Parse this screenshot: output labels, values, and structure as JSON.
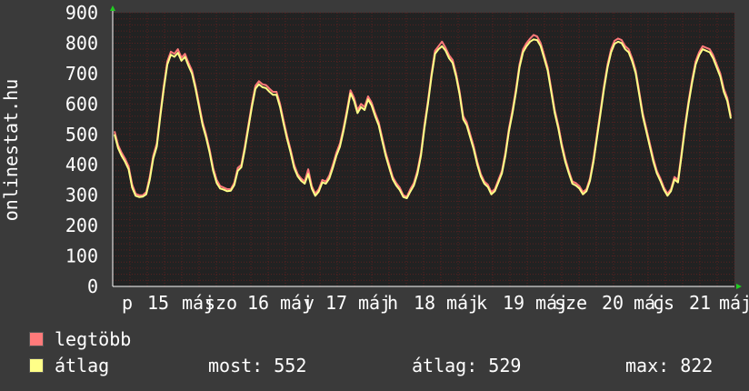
{
  "chart_data": {
    "type": "line",
    "ylabel": "onlinestat.hu",
    "ylim": [
      0,
      900
    ],
    "yticks": [
      0,
      100,
      200,
      300,
      400,
      500,
      600,
      700,
      800,
      900
    ],
    "x_tick_labels": [
      "p",
      "15",
      "máj",
      "szo",
      "16",
      "máj",
      "v",
      "17",
      "máj",
      "h",
      "18",
      "máj",
      "k",
      "19",
      "máj",
      "sze",
      "20",
      "máj",
      "cs",
      "21",
      "máj"
    ],
    "grid": true,
    "series": [
      {
        "name": "legtöbb",
        "color": "#ff7a7a",
        "values": [
          510,
          465,
          440,
          420,
          395,
          335,
          305,
          300,
          300,
          310,
          360,
          430,
          470,
          570,
          660,
          740,
          772,
          765,
          780,
          752,
          765,
          735,
          710,
          660,
          600,
          540,
          500,
          450,
          390,
          350,
          330,
          325,
          320,
          320,
          340,
          390,
          400,
          460,
          530,
          600,
          660,
          675,
          665,
          662,
          650,
          640,
          640,
          600,
          545,
          495,
          450,
          400,
          370,
          355,
          345,
          385,
          330,
          305,
          320,
          350,
          345,
          365,
          400,
          440,
          470,
          520,
          580,
          645,
          620,
          580,
          600,
          590,
          625,
          605,
          570,
          540,
          490,
          440,
          400,
          360,
          340,
          325,
          300,
          295,
          320,
          340,
          380,
          440,
          530,
          610,
          700,
          775,
          790,
          805,
          785,
          760,
          745,
          700,
          640,
          560,
          540,
          500,
          460,
          410,
          370,
          345,
          335,
          310,
          320,
          350,
          380,
          440,
          520,
          580,
          650,
          730,
          780,
          800,
          815,
          827,
          822,
          800,
          760,
          720,
          650,
          580,
          530,
          470,
          420,
          380,
          345,
          340,
          330,
          310,
          320,
          355,
          420,
          500,
          580,
          660,
          730,
          780,
          808,
          815,
          810,
          790,
          780,
          750,
          710,
          640,
          570,
          520,
          470,
          420,
          380,
          355,
          325,
          305,
          320,
          360,
          350,
          440,
          530,
          610,
          680,
          740,
          770,
          790,
          785,
          780,
          760,
          730,
          700,
          650,
          620,
          560
        ]
      },
      {
        "name": "átlag",
        "color": "#ffff88",
        "values": [
          500,
          455,
          430,
          410,
          385,
          325,
          298,
          294,
          295,
          303,
          350,
          420,
          460,
          560,
          650,
          730,
          762,
          755,
          768,
          742,
          755,
          725,
          700,
          650,
          590,
          530,
          490,
          440,
          380,
          340,
          322,
          318,
          313,
          315,
          333,
          380,
          392,
          450,
          520,
          590,
          650,
          665,
          655,
          652,
          640,
          630,
          630,
          590,
          535,
          485,
          440,
          390,
          362,
          347,
          338,
          370,
          322,
          298,
          312,
          342,
          338,
          355,
          390,
          430,
          460,
          510,
          570,
          635,
          610,
          570,
          590,
          580,
          615,
          595,
          560,
          530,
          480,
          430,
          390,
          352,
          332,
          317,
          294,
          290,
          312,
          332,
          370,
          430,
          520,
          600,
          690,
          765,
          780,
          790,
          775,
          750,
          735,
          690,
          630,
          550,
          530,
          490,
          450,
          400,
          362,
          338,
          327,
          303,
          313,
          342,
          372,
          430,
          510,
          570,
          640,
          720,
          770,
          790,
          805,
          812,
          810,
          790,
          750,
          710,
          640,
          570,
          520,
          460,
          410,
          372,
          338,
          332,
          322,
          303,
          313,
          347,
          410,
          490,
          570,
          650,
          720,
          770,
          798,
          805,
          800,
          780,
          770,
          740,
          700,
          630,
          560,
          510,
          460,
          410,
          372,
          347,
          318,
          298,
          313,
          352,
          342,
          430,
          520,
          600,
          670,
          730,
          760,
          780,
          775,
          770,
          750,
          720,
          690,
          640,
          610,
          552
        ]
      }
    ]
  },
  "legend": {
    "items": [
      {
        "label": "legtöbb",
        "color": "#ff7a7a"
      },
      {
        "label": "átlag",
        "color": "#ffff88"
      }
    ]
  },
  "stats": {
    "most": "most: 552",
    "atlag": "átlag: 529",
    "max": "max: 822"
  },
  "colors": {
    "background": "#3a3a3a",
    "plot_background": "#222222",
    "grid": "#5a2020"
  }
}
